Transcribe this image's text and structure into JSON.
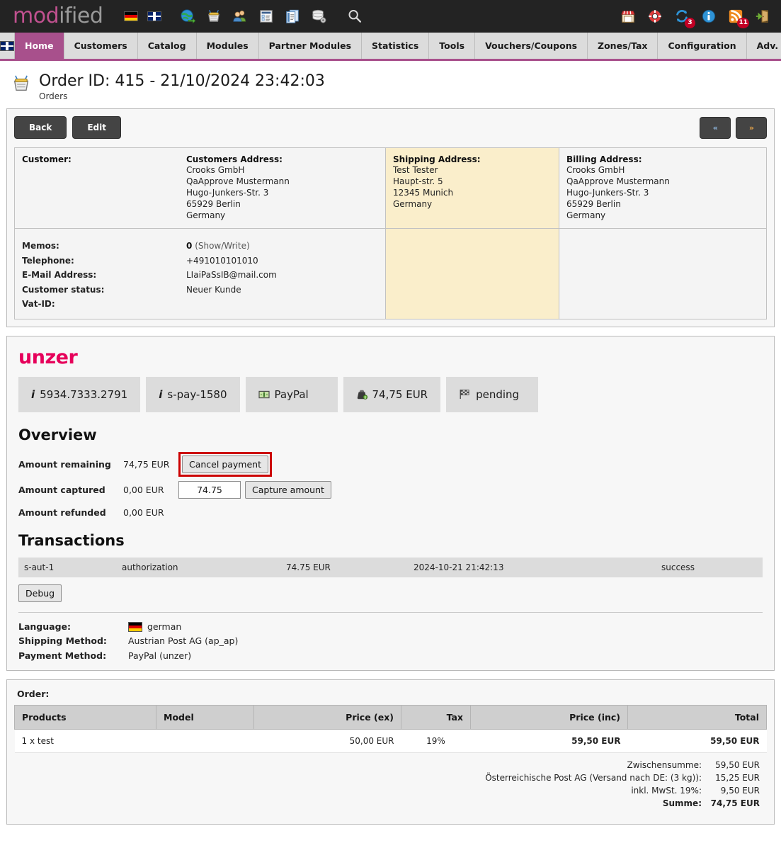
{
  "topbar": {
    "logo_mod": "mod",
    "logo_ified": "ified",
    "icons": [
      {
        "name": "flag-de-icon",
        "label": "German"
      },
      {
        "name": "flag-gb-icon",
        "label": "English"
      },
      {
        "name": "globe-shop-icon",
        "label": "Open shop"
      },
      {
        "name": "basket-icon",
        "label": "Orders"
      },
      {
        "name": "customers-icon",
        "label": "Customers"
      },
      {
        "name": "catalog-icon",
        "label": "Catalog"
      },
      {
        "name": "modules-icon",
        "label": "Modules"
      },
      {
        "name": "database-icon",
        "label": "Database"
      },
      {
        "name": "search-icon",
        "label": "Search"
      }
    ],
    "right_icons": [
      {
        "name": "storefront-icon",
        "label": "Shop",
        "badge": ""
      },
      {
        "name": "lifebuoy-icon",
        "label": "Support",
        "badge": ""
      },
      {
        "name": "refresh-icon",
        "label": "Updates",
        "badge": "3"
      },
      {
        "name": "info-icon",
        "label": "Info",
        "badge": ""
      },
      {
        "name": "rss-icon",
        "label": "News",
        "badge": "11"
      },
      {
        "name": "logout-icon",
        "label": "Logout",
        "badge": ""
      }
    ]
  },
  "menu": {
    "items": [
      {
        "label": "Home",
        "active": true
      },
      {
        "label": "Customers",
        "active": false
      },
      {
        "label": "Catalog",
        "active": false
      },
      {
        "label": "Modules",
        "active": false
      },
      {
        "label": "Partner Modules",
        "active": false
      },
      {
        "label": "Statistics",
        "active": false
      },
      {
        "label": "Tools",
        "active": false
      },
      {
        "label": "Vouchers/Coupons",
        "active": false
      },
      {
        "label": "Zones/Tax",
        "active": false
      },
      {
        "label": "Configuration",
        "active": false
      },
      {
        "label": "Adv. Configuration",
        "active": false
      }
    ]
  },
  "page": {
    "title": "Order ID: 415 - 21/10/2024 23:42:03",
    "subtitle": "Orders",
    "back_label": "Back",
    "edit_label": "Edit",
    "prev_label": "«",
    "next_label": "»"
  },
  "customer": {
    "heading": "Customer:",
    "address_heading": "Customers Address:",
    "address_lines": [
      "Crooks GmbH",
      "QaApprove Mustermann",
      "Hugo-Junkers-Str. 3",
      "65929 Berlin",
      "Germany"
    ],
    "memos_label": "Memos:",
    "memos_value": "0",
    "memos_link": "(Show/Write)",
    "telephone_label": "Telephone:",
    "telephone_value": "+491010101010",
    "email_label": "E-Mail Address:",
    "email_value": "LIaiPaSsIB@mail.com",
    "status_label": "Customer status:",
    "status_value": "Neuer Kunde",
    "vatid_label": "Vat-ID:",
    "vatid_value": ""
  },
  "shipping_address": {
    "heading": "Shipping Address:",
    "lines": [
      "Test Tester",
      "Haupt-str. 5",
      "12345 Munich",
      "Germany"
    ]
  },
  "billing_address": {
    "heading": "Billing Address:",
    "lines": [
      "Crooks GmbH",
      "QaApprove Mustermann",
      "Hugo-Junkers-Str. 3",
      "65929 Berlin",
      "Germany"
    ]
  },
  "unzer": {
    "logo": "unzer",
    "brand_color": "#e6005a",
    "infoboxes": [
      {
        "icon": "info-italic-icon",
        "label": "5934.7333.2791"
      },
      {
        "icon": "info-italic-icon",
        "label": "s-pay-1580"
      },
      {
        "icon": "banknote-icon",
        "label": "PayPal"
      },
      {
        "icon": "money-bag-icon",
        "label": "74,75 EUR"
      },
      {
        "icon": "checkered-flag-icon",
        "label": "pending"
      }
    ],
    "overview_title": "Overview",
    "rows": [
      {
        "label": "Amount remaining",
        "amount": "74,75 EUR"
      },
      {
        "label": "Amount captured",
        "amount": "0,00 EUR"
      },
      {
        "label": "Amount refunded",
        "amount": "0,00 EUR"
      }
    ],
    "cancel_payment_label": "Cancel payment",
    "capture_input_value": "74.75",
    "capture_button_label": "Capture amount",
    "highlight_color": "#cc0000",
    "transactions_title": "Transactions",
    "transactions": [
      {
        "id": "s-aut-1",
        "type": "authorization",
        "amount": "74.75 EUR",
        "date": "2024-10-21 21:42:13",
        "status": "success"
      }
    ],
    "debug_label": "Debug"
  },
  "order_meta": {
    "language_label": "Language:",
    "language_value": "german",
    "shipping_label": "Shipping Method:",
    "shipping_value": "Austrian Post AG (ap_ap)",
    "payment_label": "Payment Method:",
    "payment_value": "PayPal (unzer)"
  },
  "order": {
    "label": "Order:",
    "columns": [
      "Products",
      "Model",
      "Price (ex)",
      "Tax",
      "Price (inc)",
      "Total"
    ],
    "rows": [
      {
        "products": "1 x  test",
        "model": "",
        "price_ex": "50,00 EUR",
        "tax": "19%",
        "price_inc": "59,50 EUR",
        "total": "59,50 EUR"
      }
    ],
    "totals": [
      {
        "label": "Zwischensumme:",
        "value": "59,50 EUR",
        "bold": false
      },
      {
        "label": "Österreichische Post AG (Versand nach DE: (3 kg)):",
        "value": "15,25 EUR",
        "bold": false
      },
      {
        "label": "inkl. MwSt. 19%:",
        "value": "9,50 EUR",
        "bold": false
      },
      {
        "label": "Summe:",
        "value": "74,75 EUR",
        "bold": true
      }
    ]
  }
}
